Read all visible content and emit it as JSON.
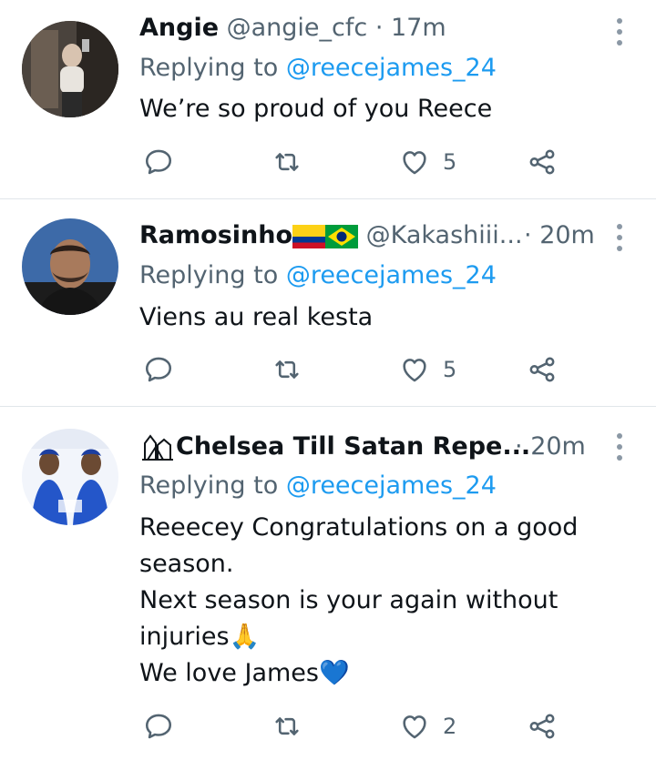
{
  "tweets": [
    {
      "name": "Angie",
      "handle": "@angie_cfc",
      "time": "17m",
      "replying_label": "Replying to",
      "replying_to": "@reecejames_24",
      "lines": [
        "We’re so proud of you Reece"
      ],
      "likes": "5"
    },
    {
      "name": "Ramosinho",
      "flags": [
        "colombia-flag",
        "brazil-flag"
      ],
      "handle": "@Kakashiii...",
      "time": "20m",
      "replying_label": "Replying to",
      "replying_to": "@reecejames_24",
      "lines": [
        "Viens au real kesta"
      ],
      "likes": "5"
    },
    {
      "name": "Chelsea Till Satan Repe...",
      "name_icon": "lion-crest-icon",
      "time": "20m",
      "replying_label": "Replying to",
      "replying_to": "@reecejames_24",
      "lines": [
        "Reeecey Congratulations on a good",
        "season.",
        "Next season is your again without",
        "injuries🙏",
        "We love James💙"
      ],
      "likes": "2"
    }
  ],
  "colors": {
    "link": "#1d9bf0",
    "muted": "#536471",
    "text": "#0f1419",
    "divider": "#e1e6ea"
  },
  "icons": [
    "reply-icon",
    "retweet-icon",
    "like-icon",
    "share-icon",
    "more-options-icon"
  ],
  "separator": "·"
}
